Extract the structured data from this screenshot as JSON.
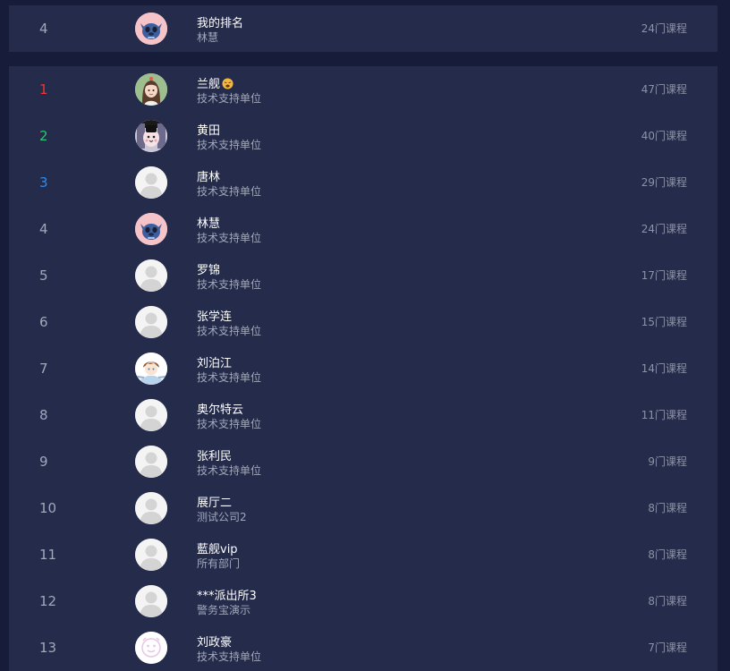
{
  "my_rank": {
    "rank": "4",
    "name": "我的排名",
    "dept": "林慧",
    "count": "24门课程",
    "avatar": "stitch-avatar"
  },
  "leaderboard": [
    {
      "rank": "1",
      "name": "兰舰",
      "dept": "技术支持单位",
      "count": "47门课程",
      "avatar": "girl-avatar",
      "emoji": "weary-face-icon"
    },
    {
      "rank": "2",
      "name": "黄田",
      "dept": "技术支持单位",
      "count": "40门课程",
      "avatar": "cat-avatar"
    },
    {
      "rank": "3",
      "name": "唐林",
      "dept": "技术支持单位",
      "count": "29门课程",
      "avatar": "default-avatar"
    },
    {
      "rank": "4",
      "name": "林慧",
      "dept": "技术支持单位",
      "count": "24门课程",
      "avatar": "stitch-avatar"
    },
    {
      "rank": "5",
      "name": "罗锦",
      "dept": "技术支持单位",
      "count": "17门课程",
      "avatar": "default-avatar"
    },
    {
      "rank": "6",
      "name": "张学连",
      "dept": "技术支持单位",
      "count": "15门课程",
      "avatar": "default-avatar"
    },
    {
      "rank": "7",
      "name": "刘泊江",
      "dept": "技术支持单位",
      "count": "14门课程",
      "avatar": "anime-boy-avatar"
    },
    {
      "rank": "8",
      "name": "奥尔特云",
      "dept": "技术支持单位",
      "count": "11门课程",
      "avatar": "default-avatar"
    },
    {
      "rank": "9",
      "name": "张利民",
      "dept": "技术支持单位",
      "count": "9门课程",
      "avatar": "default-avatar"
    },
    {
      "rank": "10",
      "name": "展厅二",
      "dept": "测试公司2",
      "count": "8门课程",
      "avatar": "default-avatar"
    },
    {
      "rank": "11",
      "name": "藍舰vip",
      "dept": "所有部门",
      "count": "8门课程",
      "avatar": "default-avatar"
    },
    {
      "rank": "12",
      "name": "***派出所3",
      "dept": "警务宝演示",
      "count": "8门课程",
      "avatar": "default-avatar"
    },
    {
      "rank": "13",
      "name": "刘政豪",
      "dept": "技术支持单位",
      "count": "7门课程",
      "avatar": "doodle-avatar"
    }
  ],
  "colors": {
    "background": "#171c3b",
    "panel": "#242b4b",
    "rank_first": "#ef3434",
    "rank_second": "#29c96e",
    "rank_third": "#2d8bf0"
  }
}
